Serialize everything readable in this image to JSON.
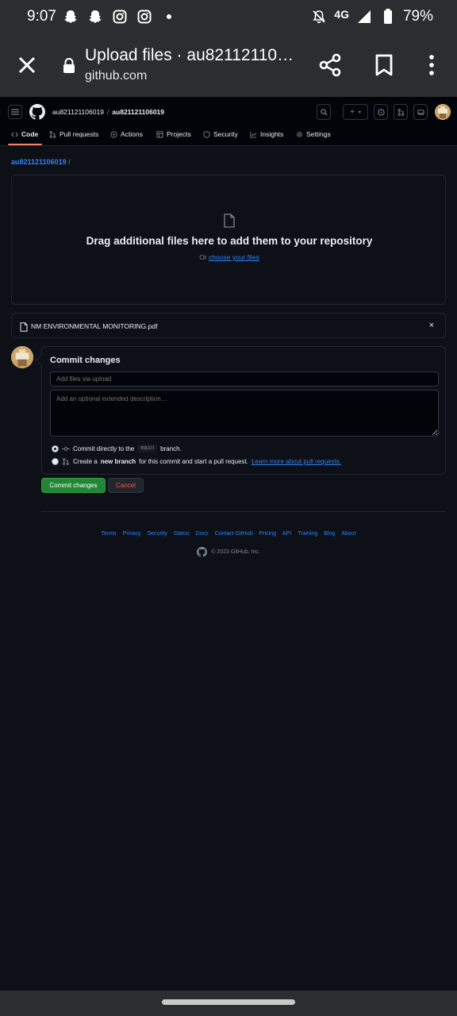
{
  "status_bar": {
    "time": "9:07",
    "network": "4G",
    "battery": "79%",
    "left_icons": [
      "snapchat-icon",
      "snapchat-icon",
      "instagram-icon",
      "instagram-icon",
      "dot-icon"
    ],
    "right_icons": [
      "do-not-disturb-icon",
      "signal-icon",
      "battery-icon"
    ]
  },
  "browser": {
    "title": "Upload files · au82112110…",
    "url": "github.com"
  },
  "github": {
    "owner": "au821121106019",
    "separator": "/",
    "repo": "au821121106019",
    "tabs": [
      {
        "label": "Code",
        "icon": "code-icon",
        "active": true
      },
      {
        "label": "Pull requests",
        "icon": "pull-request-icon"
      },
      {
        "label": "Actions",
        "icon": "play-icon"
      },
      {
        "label": "Projects",
        "icon": "table-icon"
      },
      {
        "label": "Security",
        "icon": "shield-icon"
      },
      {
        "label": "Insights",
        "icon": "graph-icon"
      },
      {
        "label": "Settings",
        "icon": "gear-icon"
      }
    ],
    "header_buttons": {
      "plus": "+",
      "plus_caret": "▾"
    }
  },
  "content": {
    "path_repo": "au821121106019",
    "path_slash": "/",
    "dropzone_title": "Drag additional files here to add them to your repository",
    "dropzone_or": "Or",
    "dropzone_link": "choose your files",
    "file_name": "NM ENVIRONMENTAL MONITORING.pdf",
    "file_remove": "×"
  },
  "commit": {
    "title": "Commit changes",
    "summary_placeholder": "Add files via upload",
    "description_placeholder": "Add an optional extended description…",
    "option1_prefix": "Commit directly to the",
    "option1_branch": "main",
    "option1_suffix": "branch.",
    "option2_prefix": "Create a",
    "option2_bold": "new branch",
    "option2_suffix": "for this commit and start a pull request.",
    "option2_link": "Learn more about pull requests.",
    "commit_button": "Commit changes",
    "cancel_button": "Cancel"
  },
  "footer": {
    "links": [
      "Terms",
      "Privacy",
      "Security",
      "Status",
      "Docs",
      "Contact GitHub",
      "Pricing",
      "API",
      "Training",
      "Blog",
      "About"
    ],
    "copyright": "© 2023 GitHub, Inc."
  },
  "colors": {
    "background": "#0d1117",
    "accent_link": "#2f81f7",
    "commit_green": "#238636",
    "cancel_red": "#f85149",
    "tab_underline": "#f78166"
  }
}
